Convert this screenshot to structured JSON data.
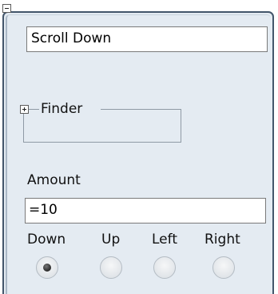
{
  "block": {
    "title": "Scroll Down",
    "finder_label": "Finder",
    "amount_label": "Amount",
    "amount_value": "=10",
    "directions": [
      {
        "label": "Down",
        "selected": true
      },
      {
        "label": "Up",
        "selected": false
      },
      {
        "label": "Left",
        "selected": false
      },
      {
        "label": "Right",
        "selected": false
      }
    ]
  },
  "icons": {
    "collapse": "collapse-icon",
    "expand": "expand-icon"
  },
  "colors": {
    "frame_border": "#43566b",
    "frame_background": "#e4ebf2",
    "radio_selected_dot": "#333333"
  }
}
